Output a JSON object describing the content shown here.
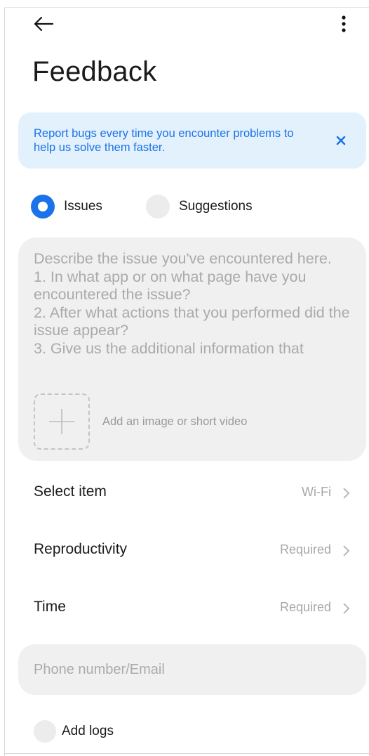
{
  "header": {
    "back_icon": "arrow-left-icon",
    "more_icon": "more-vertical-icon",
    "title": "Feedback"
  },
  "banner": {
    "text": "Report bugs every time you encounter problems to help us solve them faster.",
    "close_icon": "close-icon",
    "background": "#e3f1fd",
    "text_color": "#1a73e8"
  },
  "feedback_type": {
    "options": [
      {
        "label": "Issues",
        "selected": true
      },
      {
        "label": "Suggestions",
        "selected": false
      }
    ],
    "accent": "#1a73e8"
  },
  "description": {
    "placeholder": "Describe the issue you've encountered here.\n1. In what app or on what page have you encountered the issue?\n2. After what actions that you performed did the issue appear?\n3. Give us the additional information that",
    "add_media_icon": "plus-icon",
    "add_media_label": "Add an image or short video"
  },
  "details": {
    "select_item": {
      "label": "Select item",
      "value": "Wi-Fi"
    },
    "reproductivity": {
      "label": "Reproductivity",
      "value": "Required"
    },
    "time": {
      "label": "Time",
      "value": "Required"
    },
    "chevron_icon": "chevron-right-icon"
  },
  "contact": {
    "placeholder": "Phone number/Email",
    "value": ""
  },
  "logs": {
    "label": "Add logs",
    "checked": false
  }
}
